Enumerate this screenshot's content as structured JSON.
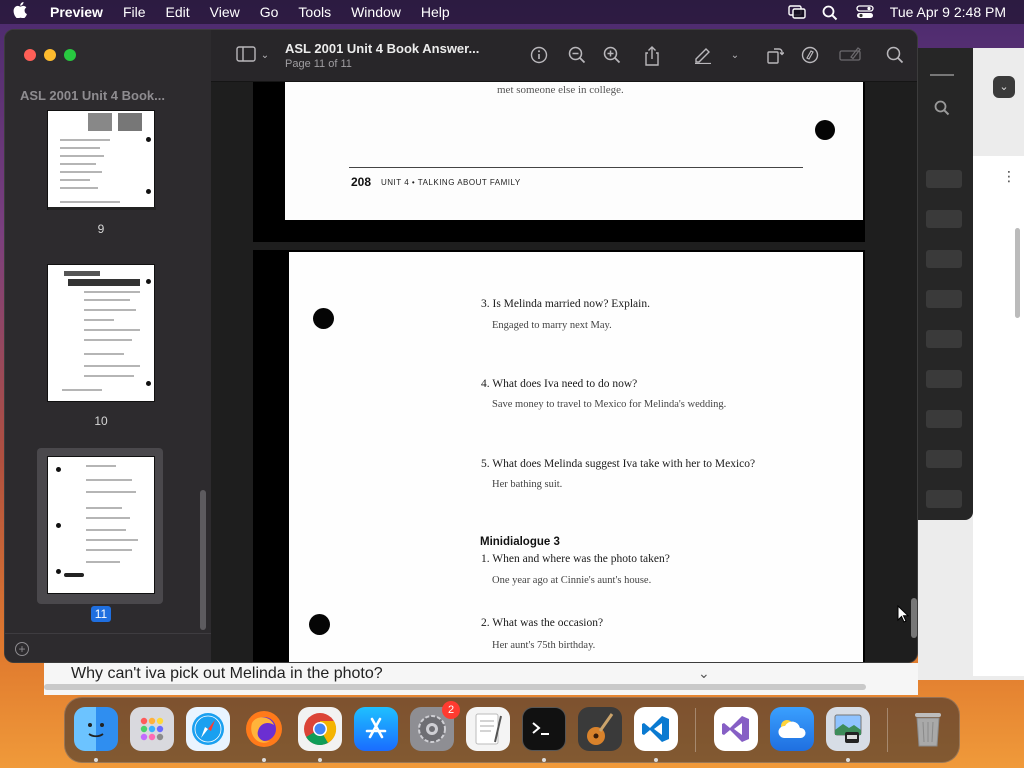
{
  "menubar": {
    "app_name": "Preview",
    "items": [
      "File",
      "Edit",
      "View",
      "Go",
      "Tools",
      "Window",
      "Help"
    ],
    "datetime": "Tue Apr 9  2:48 PM"
  },
  "window": {
    "title": "ASL 2001 Unit 4 Book Answer...",
    "subtitle": "Page 11 of 11"
  },
  "sidebar": {
    "title": "ASL 2001 Unit 4 Book...",
    "thumbnails": [
      {
        "label": "9"
      },
      {
        "label": "10"
      },
      {
        "label": "11"
      }
    ],
    "add_symbol": "+"
  },
  "previous_page": {
    "top_text": "met someone else in college.",
    "page_number": "208",
    "footer": "UNIT 4  •  TALKING ABOUT FAMILY"
  },
  "current_page": {
    "items": [
      {
        "q": "3. Is Melinda married now?  Explain.",
        "a": "Engaged to marry next May."
      },
      {
        "q": "4. What does Iva need to do now?",
        "a": "Save money to travel to Mexico for Melinda's wedding."
      },
      {
        "q": "5. What does Melinda suggest Iva take with her to Mexico?",
        "a": "Her bathing suit."
      }
    ],
    "section_heading": "Minidialogue 3",
    "section_items": [
      {
        "q": "1. When and where was the photo taken?",
        "a": "One year ago at Cinnie's aunt's house."
      },
      {
        "q": "2. What was the occasion?",
        "a": "Her aunt's 75th birthday."
      }
    ]
  },
  "underlying": {
    "question": "Why can't iva pick out Melinda in the photo?"
  },
  "dock": {
    "apps": [
      {
        "name": "Finder",
        "icon": "finder-icon",
        "color": "#2f8ef0"
      },
      {
        "name": "Launchpad",
        "icon": "launchpad-icon",
        "color": "#d9d9de"
      },
      {
        "name": "Safari",
        "icon": "safari-icon",
        "color": "#1aa0f0"
      },
      {
        "name": "Firefox",
        "icon": "firefox-icon",
        "color": "#ff7a1a"
      },
      {
        "name": "Chrome",
        "icon": "chrome-icon",
        "color": "#f2f2f2"
      },
      {
        "name": "App Store",
        "icon": "app-store-icon",
        "color": "#1a8cff"
      },
      {
        "name": "System Settings",
        "icon": "gear-icon",
        "color": "#8e8e93",
        "badge": "2"
      },
      {
        "name": "TextEdit",
        "icon": "textedit-icon",
        "color": "#f4f4f4"
      },
      {
        "name": "Terminal",
        "icon": "terminal-icon",
        "color": "#111111"
      },
      {
        "name": "GarageBand",
        "icon": "guitar-icon",
        "color": "#3a3a3a"
      },
      {
        "name": "Visual Studio Code",
        "icon": "vscode-icon",
        "color": "#ffffff"
      },
      {
        "name": "Visual Studio",
        "icon": "visual-studio-icon",
        "color": "#ffffff"
      },
      {
        "name": "Weather",
        "icon": "weather-icon",
        "color": "#2f86e8"
      },
      {
        "name": "Preview",
        "icon": "preview-icon",
        "color": "#d7dde6"
      },
      {
        "name": "Trash",
        "icon": "trash-icon",
        "color": "#9a9a9a"
      }
    ]
  }
}
